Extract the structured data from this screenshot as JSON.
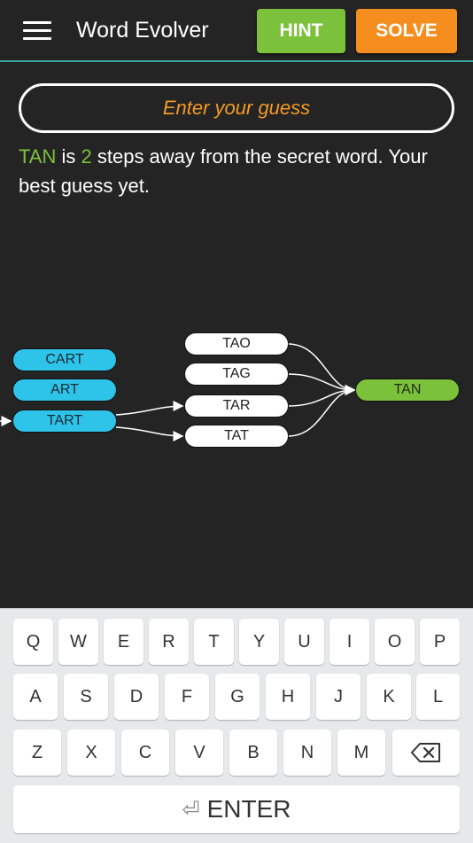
{
  "header": {
    "title": "Word Evolver",
    "hint_label": "HINT",
    "solve_label": "SOLVE",
    "accent_line": "#3aa59a"
  },
  "guess": {
    "placeholder": "Enter your guess"
  },
  "status": {
    "word": "TAN",
    "part1": " is ",
    "steps": "2",
    "part2": " steps away from the secret word. Your best guess yet."
  },
  "graph": {
    "left_nodes": [
      "CART",
      "ART",
      "TART"
    ],
    "middle_nodes": [
      "TAO",
      "TAG",
      "TAR",
      "TAT"
    ],
    "target_node": "TAN"
  },
  "keyboard": {
    "row1": [
      "Q",
      "W",
      "E",
      "R",
      "T",
      "Y",
      "U",
      "I",
      "O",
      "P"
    ],
    "row2": [
      "A",
      "S",
      "D",
      "F",
      "G",
      "H",
      "J",
      "K",
      "L"
    ],
    "row3": [
      "Z",
      "X",
      "C",
      "V",
      "B",
      "N",
      "M"
    ],
    "enter_label": "ENTER"
  },
  "colors": {
    "hint": "#7cc13b",
    "solve": "#f58e1f",
    "blue_node": "#2ec4ea",
    "green_node": "#7cc13b"
  }
}
